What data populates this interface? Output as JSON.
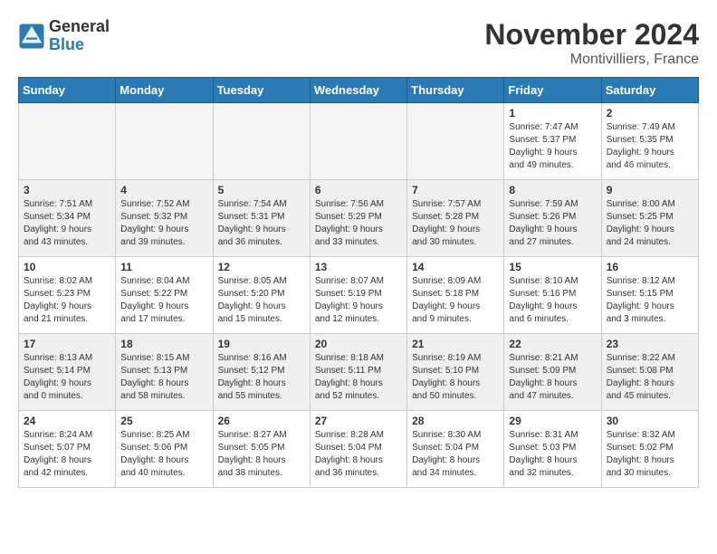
{
  "header": {
    "logo_general": "General",
    "logo_blue": "Blue",
    "month_title": "November 2024",
    "location": "Montivilliers, France"
  },
  "weekdays": [
    "Sunday",
    "Monday",
    "Tuesday",
    "Wednesday",
    "Thursday",
    "Friday",
    "Saturday"
  ],
  "rows": [
    [
      {
        "day": "",
        "info": ""
      },
      {
        "day": "",
        "info": ""
      },
      {
        "day": "",
        "info": ""
      },
      {
        "day": "",
        "info": ""
      },
      {
        "day": "",
        "info": ""
      },
      {
        "day": "1",
        "info": "Sunrise: 7:47 AM\nSunset: 5:37 PM\nDaylight: 9 hours\nand 49 minutes."
      },
      {
        "day": "2",
        "info": "Sunrise: 7:49 AM\nSunset: 5:35 PM\nDaylight: 9 hours\nand 46 minutes."
      }
    ],
    [
      {
        "day": "3",
        "info": "Sunrise: 7:51 AM\nSunset: 5:34 PM\nDaylight: 9 hours\nand 43 minutes."
      },
      {
        "day": "4",
        "info": "Sunrise: 7:52 AM\nSunset: 5:32 PM\nDaylight: 9 hours\nand 39 minutes."
      },
      {
        "day": "5",
        "info": "Sunrise: 7:54 AM\nSunset: 5:31 PM\nDaylight: 9 hours\nand 36 minutes."
      },
      {
        "day": "6",
        "info": "Sunrise: 7:56 AM\nSunset: 5:29 PM\nDaylight: 9 hours\nand 33 minutes."
      },
      {
        "day": "7",
        "info": "Sunrise: 7:57 AM\nSunset: 5:28 PM\nDaylight: 9 hours\nand 30 minutes."
      },
      {
        "day": "8",
        "info": "Sunrise: 7:59 AM\nSunset: 5:26 PM\nDaylight: 9 hours\nand 27 minutes."
      },
      {
        "day": "9",
        "info": "Sunrise: 8:00 AM\nSunset: 5:25 PM\nDaylight: 9 hours\nand 24 minutes."
      }
    ],
    [
      {
        "day": "10",
        "info": "Sunrise: 8:02 AM\nSunset: 5:23 PM\nDaylight: 9 hours\nand 21 minutes."
      },
      {
        "day": "11",
        "info": "Sunrise: 8:04 AM\nSunset: 5:22 PM\nDaylight: 9 hours\nand 17 minutes."
      },
      {
        "day": "12",
        "info": "Sunrise: 8:05 AM\nSunset: 5:20 PM\nDaylight: 9 hours\nand 15 minutes."
      },
      {
        "day": "13",
        "info": "Sunrise: 8:07 AM\nSunset: 5:19 PM\nDaylight: 9 hours\nand 12 minutes."
      },
      {
        "day": "14",
        "info": "Sunrise: 8:09 AM\nSunset: 5:18 PM\nDaylight: 9 hours\nand 9 minutes."
      },
      {
        "day": "15",
        "info": "Sunrise: 8:10 AM\nSunset: 5:16 PM\nDaylight: 9 hours\nand 6 minutes."
      },
      {
        "day": "16",
        "info": "Sunrise: 8:12 AM\nSunset: 5:15 PM\nDaylight: 9 hours\nand 3 minutes."
      }
    ],
    [
      {
        "day": "17",
        "info": "Sunrise: 8:13 AM\nSunset: 5:14 PM\nDaylight: 9 hours\nand 0 minutes."
      },
      {
        "day": "18",
        "info": "Sunrise: 8:15 AM\nSunset: 5:13 PM\nDaylight: 8 hours\nand 58 minutes."
      },
      {
        "day": "19",
        "info": "Sunrise: 8:16 AM\nSunset: 5:12 PM\nDaylight: 8 hours\nand 55 minutes."
      },
      {
        "day": "20",
        "info": "Sunrise: 8:18 AM\nSunset: 5:11 PM\nDaylight: 8 hours\nand 52 minutes."
      },
      {
        "day": "21",
        "info": "Sunrise: 8:19 AM\nSunset: 5:10 PM\nDaylight: 8 hours\nand 50 minutes."
      },
      {
        "day": "22",
        "info": "Sunrise: 8:21 AM\nSunset: 5:09 PM\nDaylight: 8 hours\nand 47 minutes."
      },
      {
        "day": "23",
        "info": "Sunrise: 8:22 AM\nSunset: 5:08 PM\nDaylight: 8 hours\nand 45 minutes."
      }
    ],
    [
      {
        "day": "24",
        "info": "Sunrise: 8:24 AM\nSunset: 5:07 PM\nDaylight: 8 hours\nand 42 minutes."
      },
      {
        "day": "25",
        "info": "Sunrise: 8:25 AM\nSunset: 5:06 PM\nDaylight: 8 hours\nand 40 minutes."
      },
      {
        "day": "26",
        "info": "Sunrise: 8:27 AM\nSunset: 5:05 PM\nDaylight: 8 hours\nand 38 minutes."
      },
      {
        "day": "27",
        "info": "Sunrise: 8:28 AM\nSunset: 5:04 PM\nDaylight: 8 hours\nand 36 minutes."
      },
      {
        "day": "28",
        "info": "Sunrise: 8:30 AM\nSunset: 5:04 PM\nDaylight: 8 hours\nand 34 minutes."
      },
      {
        "day": "29",
        "info": "Sunrise: 8:31 AM\nSunset: 5:03 PM\nDaylight: 8 hours\nand 32 minutes."
      },
      {
        "day": "30",
        "info": "Sunrise: 8:32 AM\nSunset: 5:02 PM\nDaylight: 8 hours\nand 30 minutes."
      }
    ]
  ]
}
